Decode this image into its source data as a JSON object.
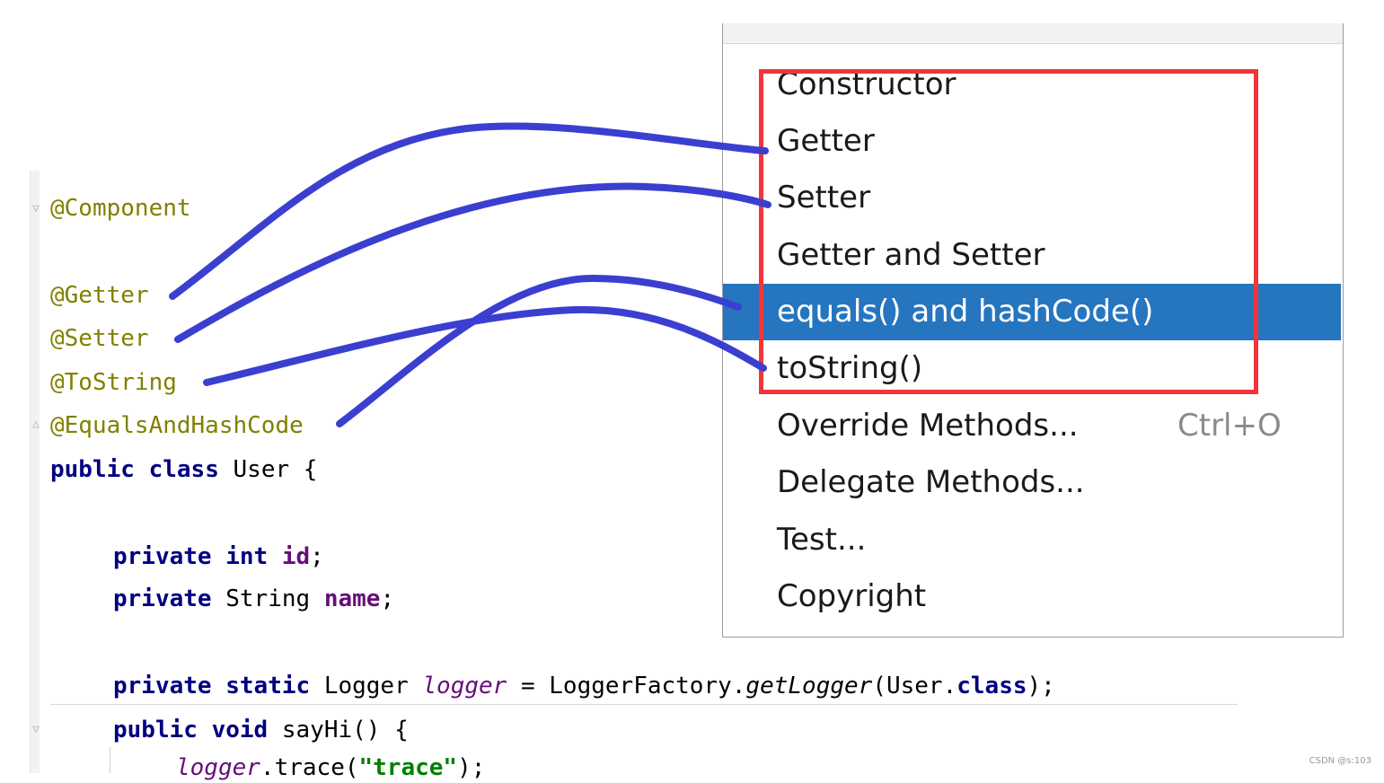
{
  "editor": {
    "annotations": [
      "@Component",
      "@Getter",
      "@Setter",
      "@ToString",
      "@EqualsAndHashCode"
    ],
    "class_decl": {
      "kw1": "public",
      "kw2": "class",
      "name": " User {"
    },
    "field_id": {
      "kw1": "private",
      "kw2": "int",
      "name": "id",
      "end": ";"
    },
    "field_name": {
      "kw1": "private",
      "type": "String",
      "name": "name",
      "end": ";"
    },
    "logger_line": {
      "kw1": "private",
      "kw2": "static",
      "type": "Logger",
      "var": "logger",
      "eq": " = LoggerFactory.",
      "method": "getLogger",
      "arg_open": "(User.",
      "kw3": "class",
      "end": ");"
    },
    "method_line": {
      "kw1": "public",
      "kw2": "void",
      "rest": " sayHi() {"
    },
    "trace_line": {
      "obj": "logger",
      "call": ".trace(",
      "str": "\"trace\"",
      "end": ");"
    }
  },
  "menu": {
    "items": [
      {
        "label": "Constructor",
        "shortcut": ""
      },
      {
        "label": "Getter",
        "shortcut": ""
      },
      {
        "label": "Setter",
        "shortcut": ""
      },
      {
        "label": "Getter and Setter",
        "shortcut": ""
      },
      {
        "label": "equals() and hashCode()",
        "shortcut": ""
      },
      {
        "label": "toString()",
        "shortcut": ""
      },
      {
        "label": "Override Methods...",
        "shortcut": "Ctrl+O"
      },
      {
        "label": "Delegate Methods...",
        "shortcut": ""
      },
      {
        "label": "Test...",
        "shortcut": ""
      },
      {
        "label": "Copyright",
        "shortcut": ""
      }
    ],
    "selected_index": 4
  },
  "colors": {
    "annotation": "#808000",
    "keyword": "#000080",
    "selection": "#2675bf",
    "highlight_box": "#f0363a",
    "connector": "#3b3fd0"
  },
  "watermark": "CSDN @s:103"
}
